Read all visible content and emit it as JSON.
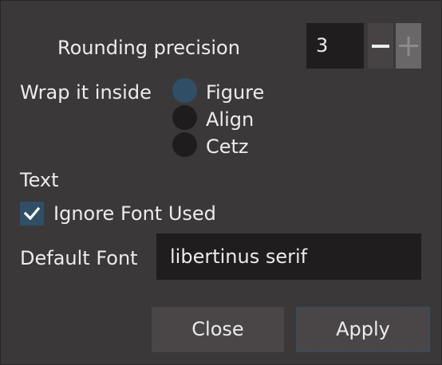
{
  "rounding": {
    "label": "Rounding precision",
    "value": "3",
    "decrement_icon": "minus-icon",
    "increment_icon": "plus-icon"
  },
  "wrap": {
    "label": "Wrap it inside",
    "options": [
      {
        "label": "Figure",
        "selected": true
      },
      {
        "label": "Align",
        "selected": false
      },
      {
        "label": "Cetz",
        "selected": false
      }
    ]
  },
  "text_section": {
    "heading": "Text",
    "ignore_font": {
      "label": "Ignore Font Used",
      "checked": true,
      "icon": "checkmark-icon"
    },
    "default_font": {
      "label": "Default Font",
      "value": "libertinus serif"
    }
  },
  "buttons": {
    "close": "Close",
    "apply": "Apply"
  },
  "colors": {
    "background": "#3b3839",
    "field": "#1f1d1e",
    "accent": "#2f4f66",
    "button": "#4a4647",
    "text": "#ececec"
  }
}
